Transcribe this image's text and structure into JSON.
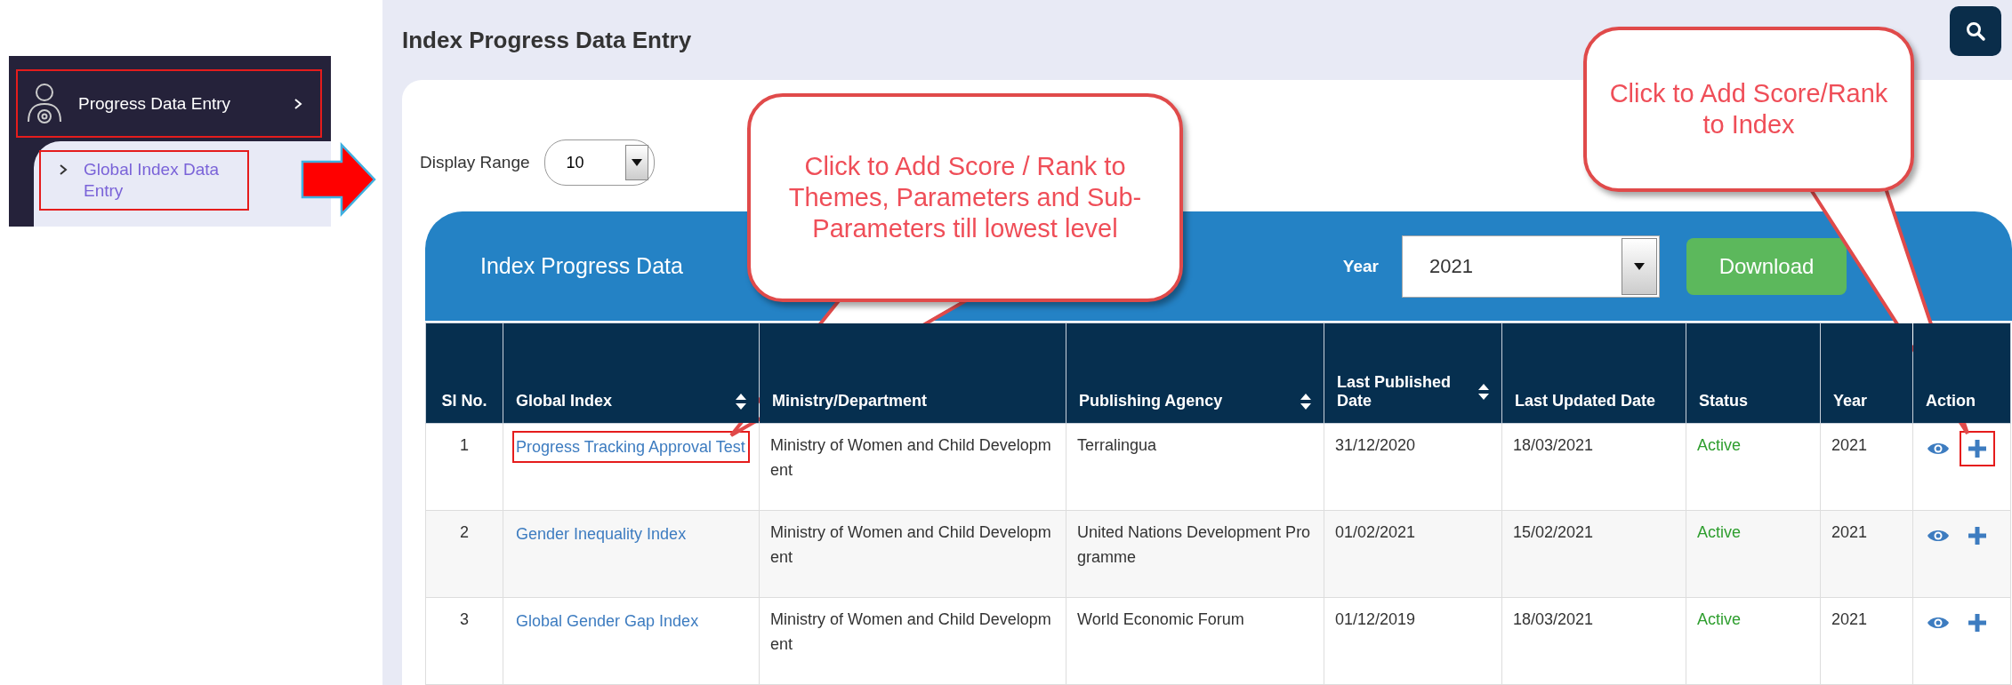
{
  "page": {
    "title": "Index Progress Data Entry"
  },
  "sidebar": {
    "items": [
      {
        "label": "Progress Data Entry",
        "highlighted": true,
        "children": [
          {
            "label": "Global Index Data Entry",
            "highlighted": true
          }
        ]
      }
    ]
  },
  "display_range": {
    "label": "Display Range",
    "value": "10"
  },
  "panel": {
    "title": "Index Progress Data",
    "year_label": "Year",
    "year_value": "2021",
    "download": "Download"
  },
  "table": {
    "columns": [
      {
        "label": "Sl No.",
        "sortable": false
      },
      {
        "label": "Global Index",
        "sortable": true
      },
      {
        "label": "Ministry/Department",
        "sortable": false
      },
      {
        "label": "Publishing Agency",
        "sortable": true
      },
      {
        "label": "Last Published Date",
        "sortable": true
      },
      {
        "label": "Last Updated Date",
        "sortable": false
      },
      {
        "label": "Status",
        "sortable": false
      },
      {
        "label": "Year",
        "sortable": false
      },
      {
        "label": "Action",
        "sortable": false
      }
    ],
    "rows": [
      {
        "sl": "1",
        "global_index": "Progress Tracking Approval Test",
        "highlighted": true,
        "ministry": "Ministry of Women and Child Development",
        "agency": "Terralingua",
        "last_published": "31/12/2020",
        "last_updated": "18/03/2021",
        "status": "Active",
        "year": "2021",
        "add_highlighted": true
      },
      {
        "sl": "2",
        "global_index": "Gender Inequality Index",
        "highlighted": false,
        "ministry": "Ministry of Women and Child Development",
        "agency": "United Nations Development Programme",
        "last_published": "01/02/2021",
        "last_updated": "15/02/2021",
        "status": "Active",
        "year": "2021",
        "add_highlighted": false
      },
      {
        "sl": "3",
        "global_index": "Global Gender Gap Index",
        "highlighted": false,
        "ministry": "Ministry of Women and Child Development",
        "agency": "World Economic Forum",
        "last_published": "01/12/2019",
        "last_updated": "18/03/2021",
        "status": "Active",
        "year": "2021",
        "add_highlighted": false
      }
    ]
  },
  "callouts": [
    {
      "text": "Click to Add Score / Rank to Themes, Parameters and Sub-Parameters till lowest level"
    },
    {
      "text": "Click to Add Score/Rank to Index"
    }
  ]
}
